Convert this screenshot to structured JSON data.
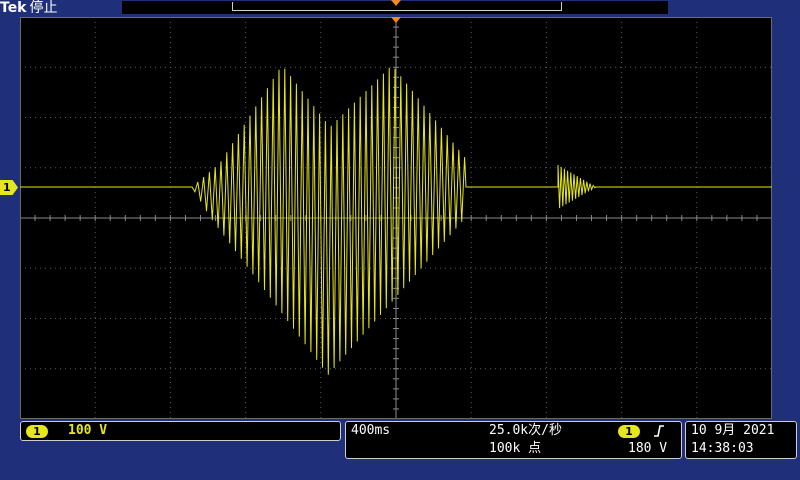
{
  "header": {
    "brand": "Tek",
    "acq_state": "停止"
  },
  "channel": {
    "number": "1",
    "scale": "100 V",
    "color": "#e6e61e"
  },
  "horizontal": {
    "time_per_div": "400ms",
    "sample_rate": "25.0k次/秒",
    "record_length": "100k 点"
  },
  "trigger": {
    "source": "1",
    "slope_icon": "rising-edge-icon",
    "level": "180 V",
    "marker_color": "#f08a1c"
  },
  "datetime": {
    "date": "10 9月  2021",
    "time": "14:38:03"
  }
}
